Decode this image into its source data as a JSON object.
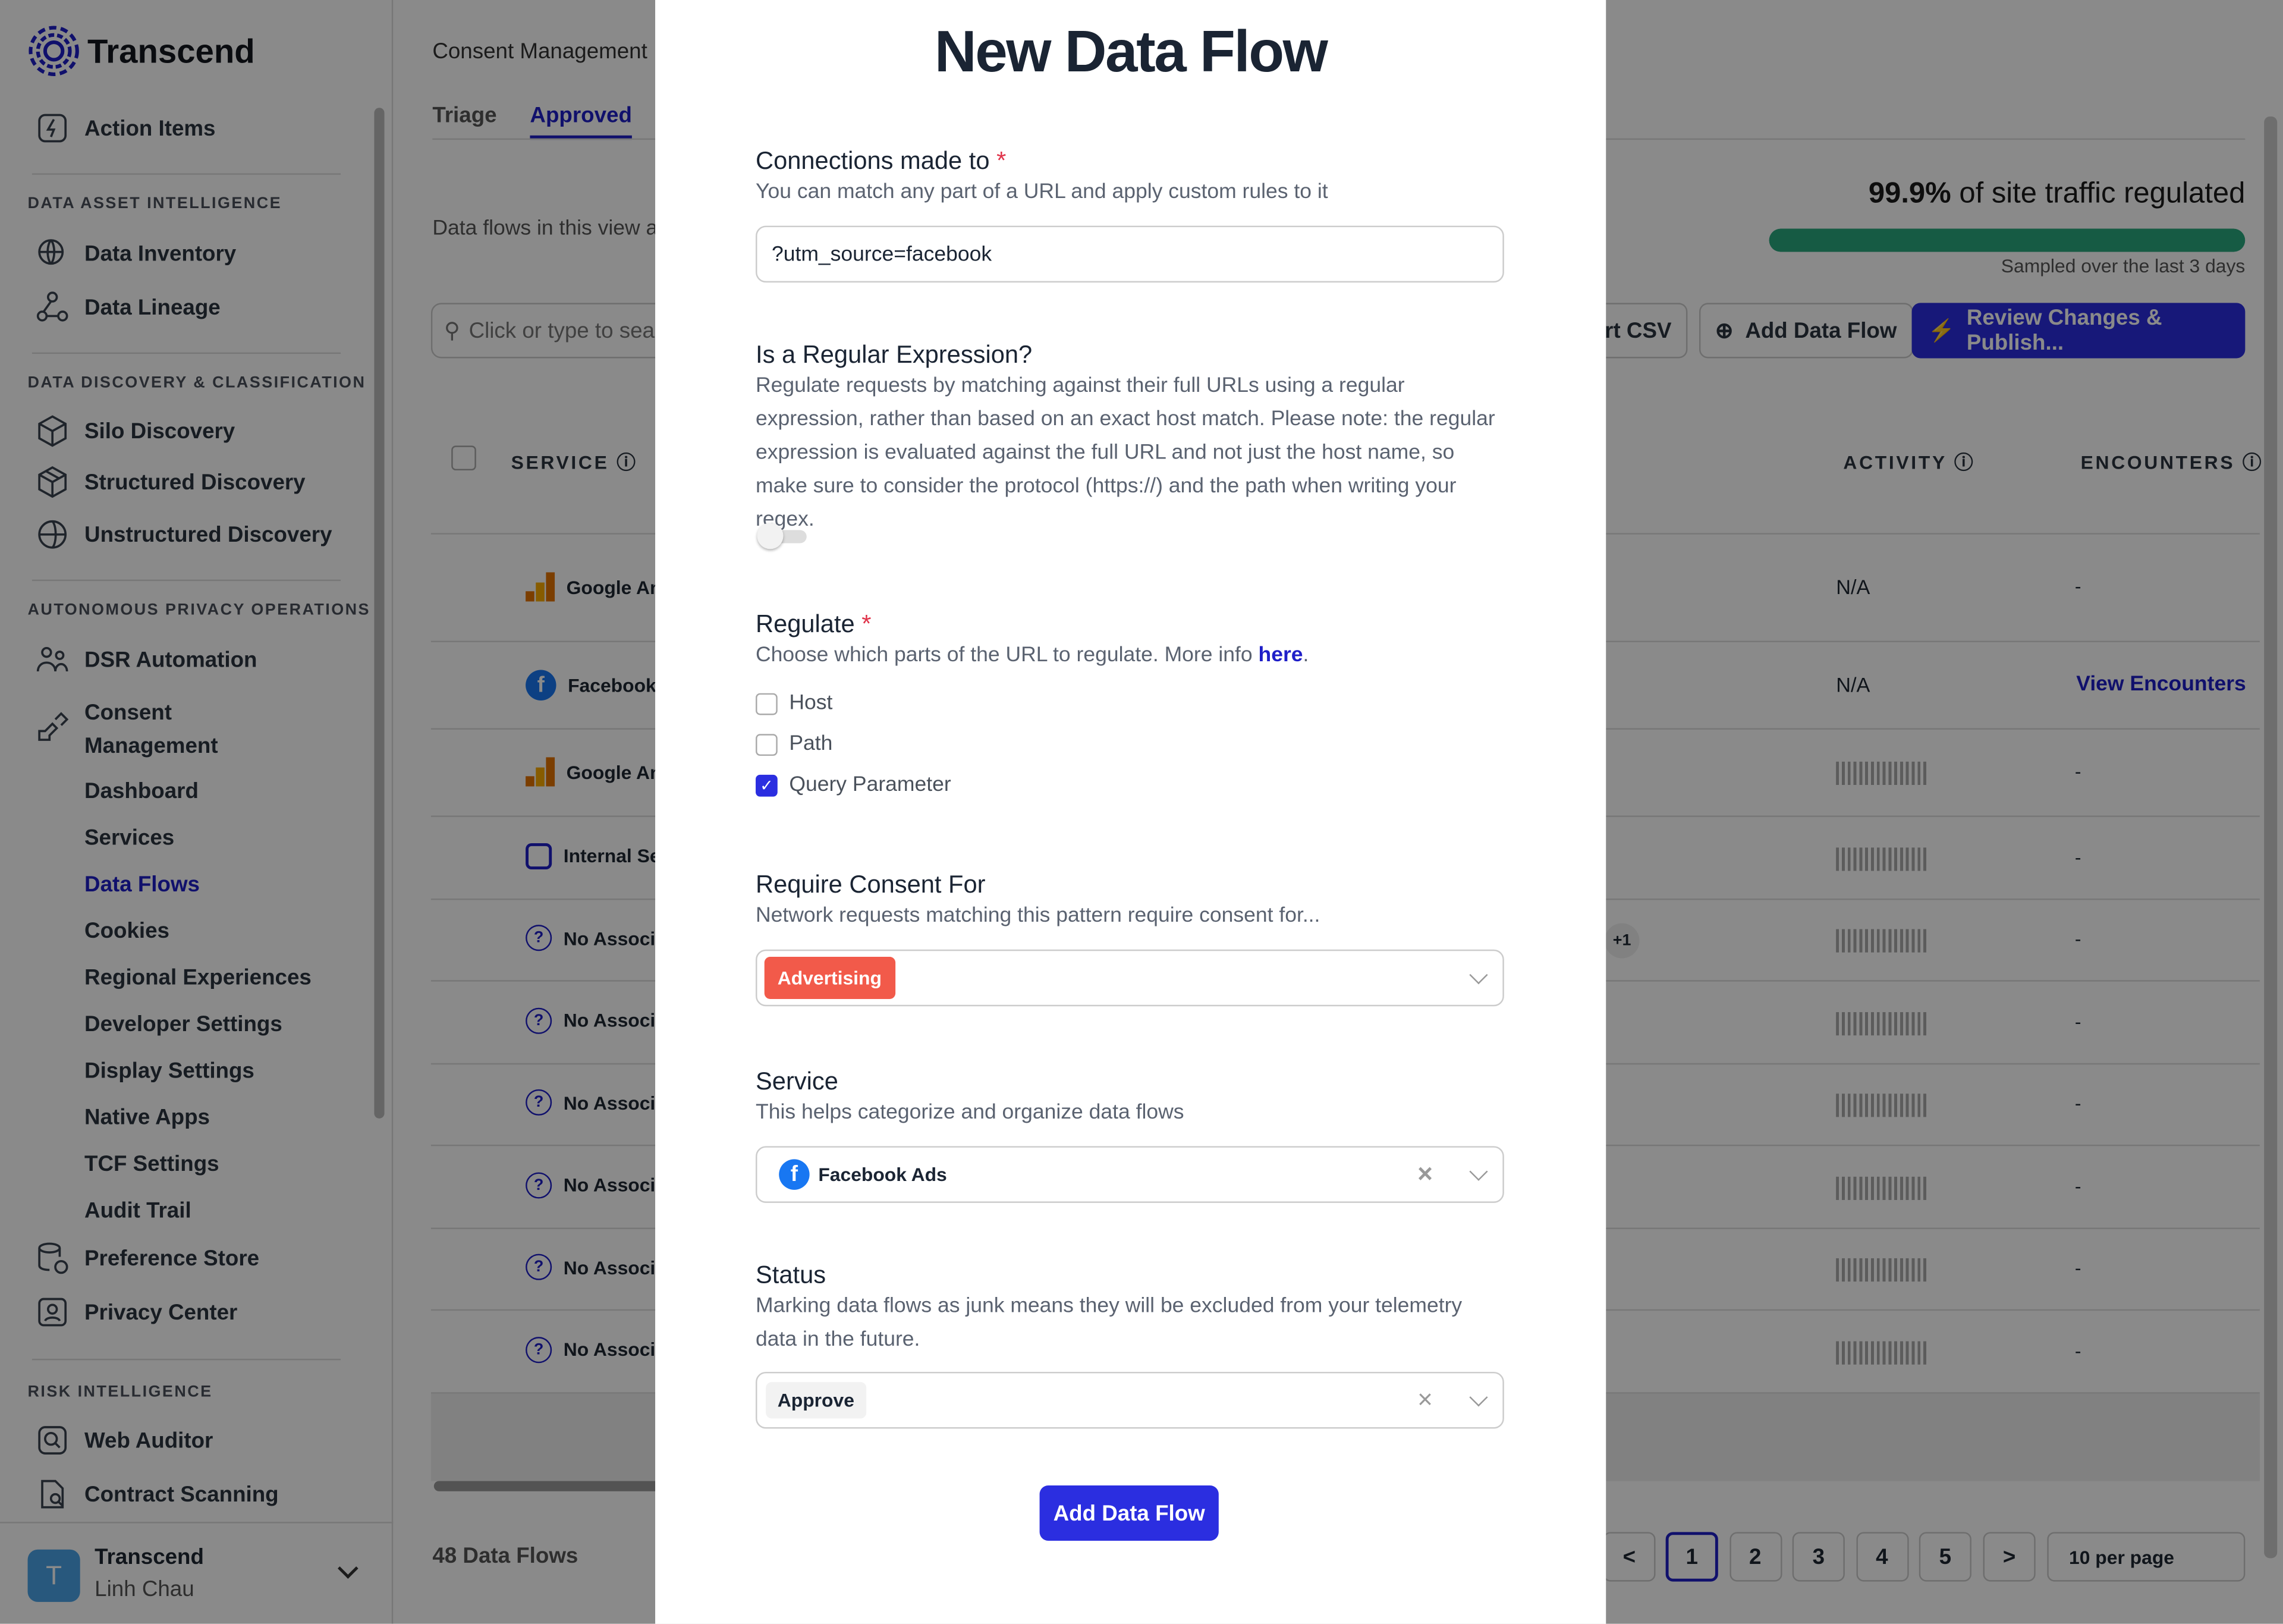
{
  "brand": {
    "name": "Transcend",
    "accent": "#1f1fc8"
  },
  "sidebar": {
    "top_item": "Action Items",
    "sections": [
      {
        "title": "DATA ASSET INTELLIGENCE",
        "items": [
          "Data Inventory",
          "Data Lineage"
        ]
      },
      {
        "title": "DATA DISCOVERY & CLASSIFICATION",
        "items": [
          "Silo Discovery",
          "Structured Discovery",
          "Unstructured Discovery"
        ]
      },
      {
        "title": "AUTONOMOUS PRIVACY OPERATIONS",
        "items": [
          "DSR Automation",
          "Consent Management",
          "Preference Store",
          "Privacy Center"
        ]
      },
      {
        "title": "RISK INTELLIGENCE",
        "items": [
          "Web Auditor",
          "Contract Scanning"
        ]
      }
    ],
    "consent_sub": [
      "Dashboard",
      "Services",
      "Data Flows",
      "Cookies",
      "Regional Experiences",
      "Developer Settings",
      "Display Settings",
      "Native Apps",
      "TCF Settings",
      "Audit Trail"
    ],
    "active_sub": "Data Flows",
    "user": {
      "initial": "T",
      "org": "Transcend",
      "name": "Linh Chau"
    }
  },
  "main": {
    "breadcrumb": "Consent Management",
    "tabs": [
      "Triage",
      "Approved"
    ],
    "active_tab": "Approved",
    "description": "Data flows in this view ar",
    "search_placeholder": "Click or type to searc",
    "traffic": {
      "percent": "99.9%",
      "text": "of site traffic regulated",
      "sampled": "Sampled over the last 3 days",
      "fill": 0.999,
      "color": "#2aa87e"
    },
    "buttons": {
      "export": "rt CSV",
      "add": "Add Data Flow",
      "publish": "Review Changes & Publish..."
    },
    "columns": {
      "service": "SERVICE",
      "activity": "ACTIVITY",
      "encounters": "ENCOUNTERS"
    },
    "rows": [
      {
        "service": "Google An",
        "icon": "google-analytics",
        "activity": "N/A",
        "encounters": "-"
      },
      {
        "service": "Facebook",
        "icon": "facebook",
        "activity": "N/A",
        "encounters": "View Encounters"
      },
      {
        "service": "Google An",
        "icon": "google-analytics",
        "activity": "",
        "encounters": "-"
      },
      {
        "service": "Internal Se",
        "icon": "server",
        "activity": "",
        "encounters": "-"
      },
      {
        "service": "No Associ",
        "icon": "question",
        "activity": "",
        "encounters": "-",
        "badge": "+1"
      },
      {
        "service": "No Associ",
        "icon": "question",
        "activity": "",
        "encounters": "-"
      },
      {
        "service": "No Associ",
        "icon": "question",
        "activity": "",
        "encounters": "-"
      },
      {
        "service": "No Associ",
        "icon": "question",
        "activity": "",
        "encounters": "-"
      },
      {
        "service": "No Associ",
        "icon": "question",
        "activity": "",
        "encounters": "-"
      },
      {
        "service": "No Associ",
        "icon": "question",
        "activity": "",
        "encounters": "-"
      }
    ],
    "count": "48 Data Flows",
    "pagination": {
      "prev": "<",
      "pages": [
        "1",
        "2",
        "3",
        "4",
        "5"
      ],
      "current": "1",
      "next": ">",
      "per_page": "10 per page"
    }
  },
  "modal": {
    "title": "New Data Flow",
    "connections": {
      "label": "Connections made to",
      "required": "*",
      "hint": "You can match any part of a URL and apply custom rules to it",
      "value": "?utm_source=facebook"
    },
    "regex": {
      "label": "Is a Regular Expression?",
      "hint": "Regulate requests by matching against their full URLs using a regular expression, rather than based on an exact host match. Please note: the regular expression is evaluated against the full URL and not just the host name, so make sure to consider the protocol (https://) and the path when writing your regex.",
      "enabled": false
    },
    "regulate": {
      "label": "Regulate",
      "required": "*",
      "hint": "Choose which parts of the URL to regulate. More info ",
      "link": "here",
      "options": [
        {
          "label": "Host",
          "checked": false
        },
        {
          "label": "Path",
          "checked": false
        },
        {
          "label": "Query Parameter",
          "checked": true
        }
      ]
    },
    "consent": {
      "label": "Require Consent For",
      "hint": "Network requests matching this pattern require consent for...",
      "tag": "Advertising",
      "tag_color": "#f25a4a"
    },
    "service": {
      "label": "Service",
      "hint": "This helps categorize and organize data flows",
      "value": "Facebook Ads"
    },
    "status": {
      "label": "Status",
      "hint": "Marking data flows as junk means they will be excluded from your telemetry data in the future.",
      "value": "Approve"
    },
    "submit": "Add Data Flow"
  }
}
